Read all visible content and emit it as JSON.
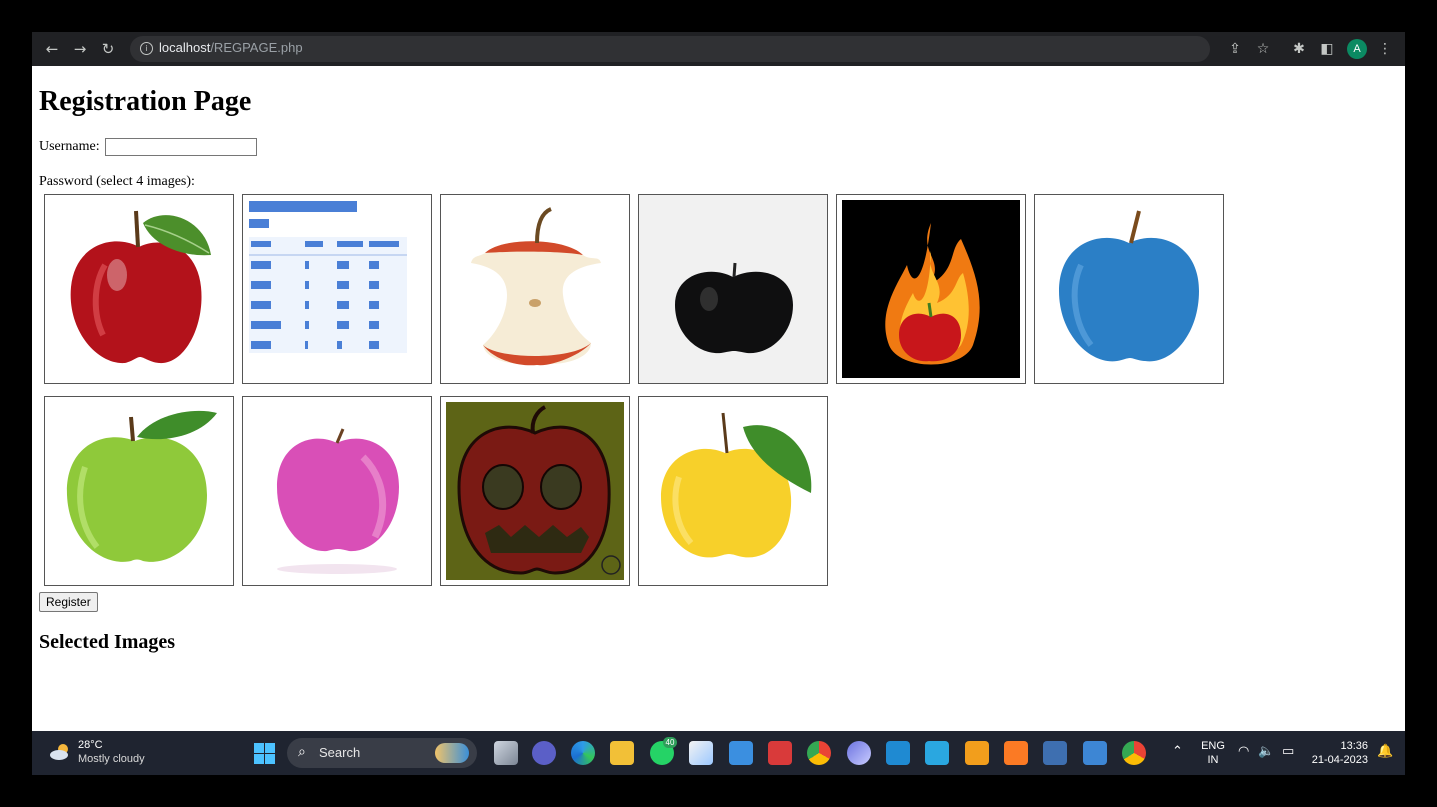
{
  "browser": {
    "url_host": "localhost",
    "url_path": "/REGPAGE.php"
  },
  "page": {
    "title": "Registration Page",
    "username_label": "Username:",
    "username_value": "",
    "password_label": "Password (select 4 images):",
    "images": [
      {
        "subject": "red apple"
      },
      {
        "subject": "table screenshot"
      },
      {
        "subject": "apple core"
      },
      {
        "subject": "black apple"
      },
      {
        "subject": "apple in flames"
      },
      {
        "subject": "blue apple"
      },
      {
        "subject": "green apple"
      },
      {
        "subject": "pink apple"
      },
      {
        "subject": "skull apple"
      },
      {
        "subject": "yellow apple"
      }
    ],
    "register_label": "Register",
    "selected_heading": "Selected Images"
  },
  "taskbar": {
    "temperature": "28°C",
    "weather": "Mostly cloudy",
    "search_label": "Search",
    "whatsapp_badge": "40",
    "language_1": "ENG",
    "language_2": "IN",
    "time": "13:36",
    "date": "21-04-2023"
  },
  "colors": {
    "chrome_bar": "#202124",
    "taskbar": "#1f2430",
    "accent_profile": "#0b8a62"
  }
}
